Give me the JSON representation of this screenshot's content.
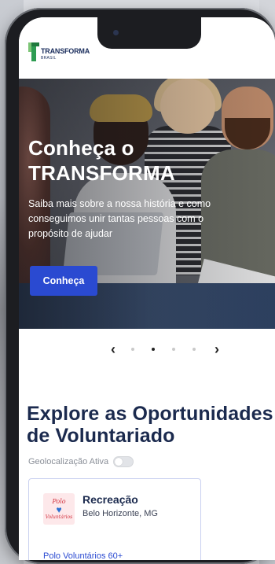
{
  "header": {
    "logo_name": "TRANSFORMA",
    "logo_sub": "BRASIL"
  },
  "hero": {
    "title": "Conheça o\nTRANSFORMA",
    "text": "Saiba mais sobre a nossa história e como conseguimos unir tantas pessoas com o propósito de ajudar",
    "button_label": "Conheça"
  },
  "carousel": {
    "prev_icon": "chevron-left-icon",
    "next_icon": "chevron-right-icon",
    "prev_glyph": "‹",
    "next_glyph": "›",
    "dot_count": 4,
    "active_index": 1
  },
  "opportunities": {
    "title": "Explore as Oportunidades\nde Voluntariado",
    "geo_label": "Geolocalização Ativa",
    "geo_enabled": false
  },
  "card": {
    "logo_line1": "Polo",
    "logo_line2": "Voluntários",
    "title": "Recreação",
    "location": "Belo Horizonte, MG",
    "org": "Polo Voluntários 60+"
  },
  "colors": {
    "primary": "#2a4ad1",
    "heading": "#1b2a4e",
    "brand_green": "#2e9c52"
  }
}
